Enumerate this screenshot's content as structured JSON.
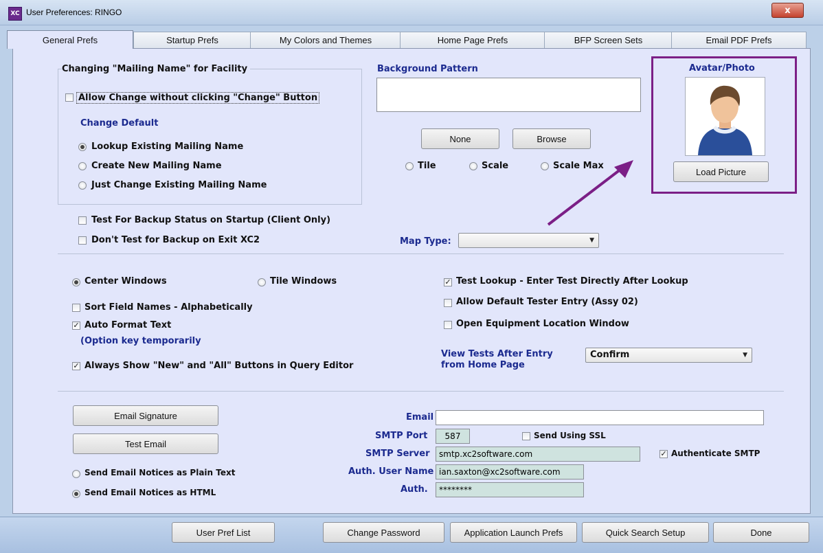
{
  "window": {
    "title": "User Preferences: RINGO",
    "close_glyph": "x",
    "app_icon_text": "XC"
  },
  "tabs": [
    "General Prefs",
    "Startup Prefs",
    "My Colors and Themes",
    "Home Page Prefs",
    "BFP Screen Sets",
    "Email PDF Prefs"
  ],
  "mailing": {
    "title": "Changing \"Mailing Name\" for Facility",
    "allow_change": "Allow Change without clicking \"Change\" Button",
    "change_default": "Change Default",
    "opt_lookup": "Lookup Existing Mailing Name",
    "opt_create": "Create New Mailing Name",
    "opt_just": "Just Change Existing Mailing Name"
  },
  "background": {
    "title": "Background Pattern",
    "none": "None",
    "browse": "Browse",
    "tile": "Tile",
    "scale": "Scale",
    "scale_max": "Scale Max"
  },
  "avatar": {
    "title": "Avatar/Photo",
    "load": "Load Picture"
  },
  "backup": {
    "test_startup": "Test For Backup Status on Startup  (Client Only)",
    "dont_test": "Don't Test for Backup on Exit XC2"
  },
  "map": {
    "label": "Map Type:",
    "value": ""
  },
  "windows": {
    "center": "Center Windows",
    "tile": "Tile Windows",
    "sort": "Sort Field Names - Alphabetically",
    "auto_format": "Auto Format Text",
    "option_note": "(Option key temporarily",
    "always_show": "Always Show \"New\" and \"All\" Buttons in Query Editor",
    "test_lookup": "Test Lookup - Enter Test Directly After Lookup",
    "allow_default": "Allow Default Tester Entry (Assy 02)",
    "open_equipment": "Open Equipment Location Window",
    "view_tests_1": "View Tests After Entry",
    "view_tests_2": "from Home Page",
    "view_tests_value": "Confirm"
  },
  "email": {
    "signature_btn": "Email Signature",
    "test_btn": "Test Email",
    "plain": "Send Email Notices as Plain Text",
    "html": "Send Email Notices as HTML",
    "email_label": "Email",
    "email_value": "",
    "port_label": "SMTP Port",
    "port_value": "587",
    "ssl": "Send Using SSL",
    "server_label": "SMTP Server",
    "server_value": "smtp.xc2software.com",
    "auth_smtp": "Authenticate SMTP",
    "user_label": "Auth. User Name",
    "user_value": "ian.saxton@xc2software.com",
    "pass_label": "Auth.",
    "pass_value": "********"
  },
  "footer": {
    "user_pref_list": "User Pref List",
    "change_password": "Change Password",
    "app_launch": "Application Launch Prefs",
    "quick_search": "Quick Search Setup",
    "done": "Done"
  },
  "state": {
    "allow_change": false,
    "test_startup": false,
    "dont_test": false,
    "sort": false,
    "auto_format": true,
    "always_show": true,
    "test_lookup": true,
    "allow_default": false,
    "open_equipment": false,
    "ssl": false,
    "auth_smtp": true
  },
  "colors": {
    "accent_purple": "#7b1f86",
    "label_blue": "#1b2a8f",
    "panel": "#e2e6fb"
  }
}
